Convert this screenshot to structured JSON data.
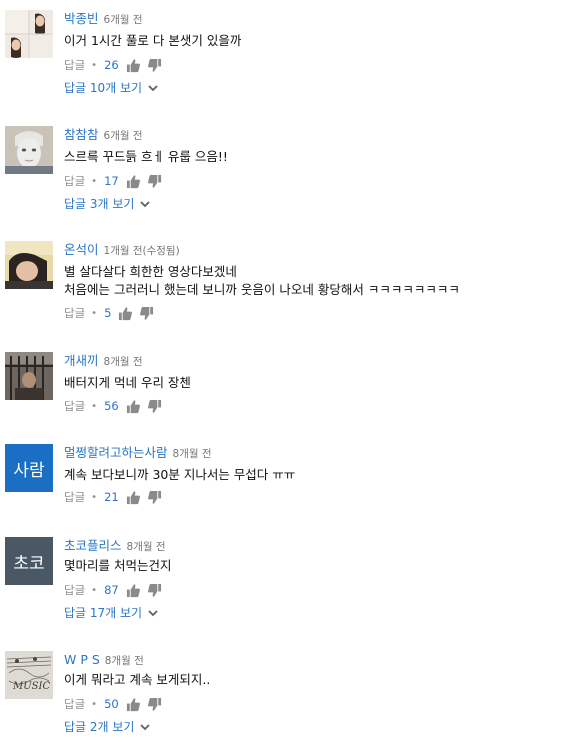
{
  "colors": {
    "link": "#2a76c6",
    "meta": "#767676",
    "action": "#8f8f8f",
    "avatar_blue": "#1a6fc4",
    "avatar_dark": "#4a5866"
  },
  "comments": [
    {
      "author": "박종빈",
      "time": "6개월 전",
      "text": [
        "이거 1시간 풀로 다 본샛기 있을까"
      ],
      "reply": "답글",
      "likes": "26",
      "replies": "답글 10개 보기",
      "avatar": "photo"
    },
    {
      "author": "참참참",
      "time": "6개월 전",
      "text": [
        "스르륵 꾸드듥 흐ㅔ 유룹 으음!!"
      ],
      "reply": "답글",
      "likes": "17",
      "replies": "답글 3개 보기",
      "avatar": "photo"
    },
    {
      "author": "온석이",
      "time": "1개월 전(수정됨)",
      "text": [
        "별 살다살다 희한한 영상다보겠네",
        "처음에는 그러러니 했는데 보니까 웃음이 나오네 황당해서 ㅋㅋㅋㅋㅋㅋㅋㅋ"
      ],
      "reply": "답글",
      "likes": "5",
      "replies": "",
      "avatar": "photo"
    },
    {
      "author": "개새끼",
      "time": "8개월 전",
      "text": [
        "배터지게 먹네 우리 장첸"
      ],
      "reply": "답글",
      "likes": "56",
      "replies": "",
      "avatar": "photo"
    },
    {
      "author": "멀쩡할려고하는사람",
      "time": "8개월 전",
      "text": [
        "계속 보다보니까 30분 지나서는 무섭다 ㅠㅠ"
      ],
      "reply": "답글",
      "likes": "21",
      "replies": "",
      "avatar": "text",
      "avatar_text": "사람",
      "avatar_color": "#1a6fc4"
    },
    {
      "author": "초코플리스",
      "time": "8개월 전",
      "text": [
        "몇마리를 처먹는건지"
      ],
      "reply": "답글",
      "likes": "87",
      "replies": "답글 17개 보기",
      "avatar": "text",
      "avatar_text": "초코",
      "avatar_color": "#4a5866"
    },
    {
      "author": "W P S",
      "time": "8개월 전",
      "text": [
        "이게 뭐라고 계속 보게되지.."
      ],
      "reply": "답글",
      "likes": "50",
      "replies": "답글 2개 보기",
      "avatar": "photo"
    }
  ]
}
